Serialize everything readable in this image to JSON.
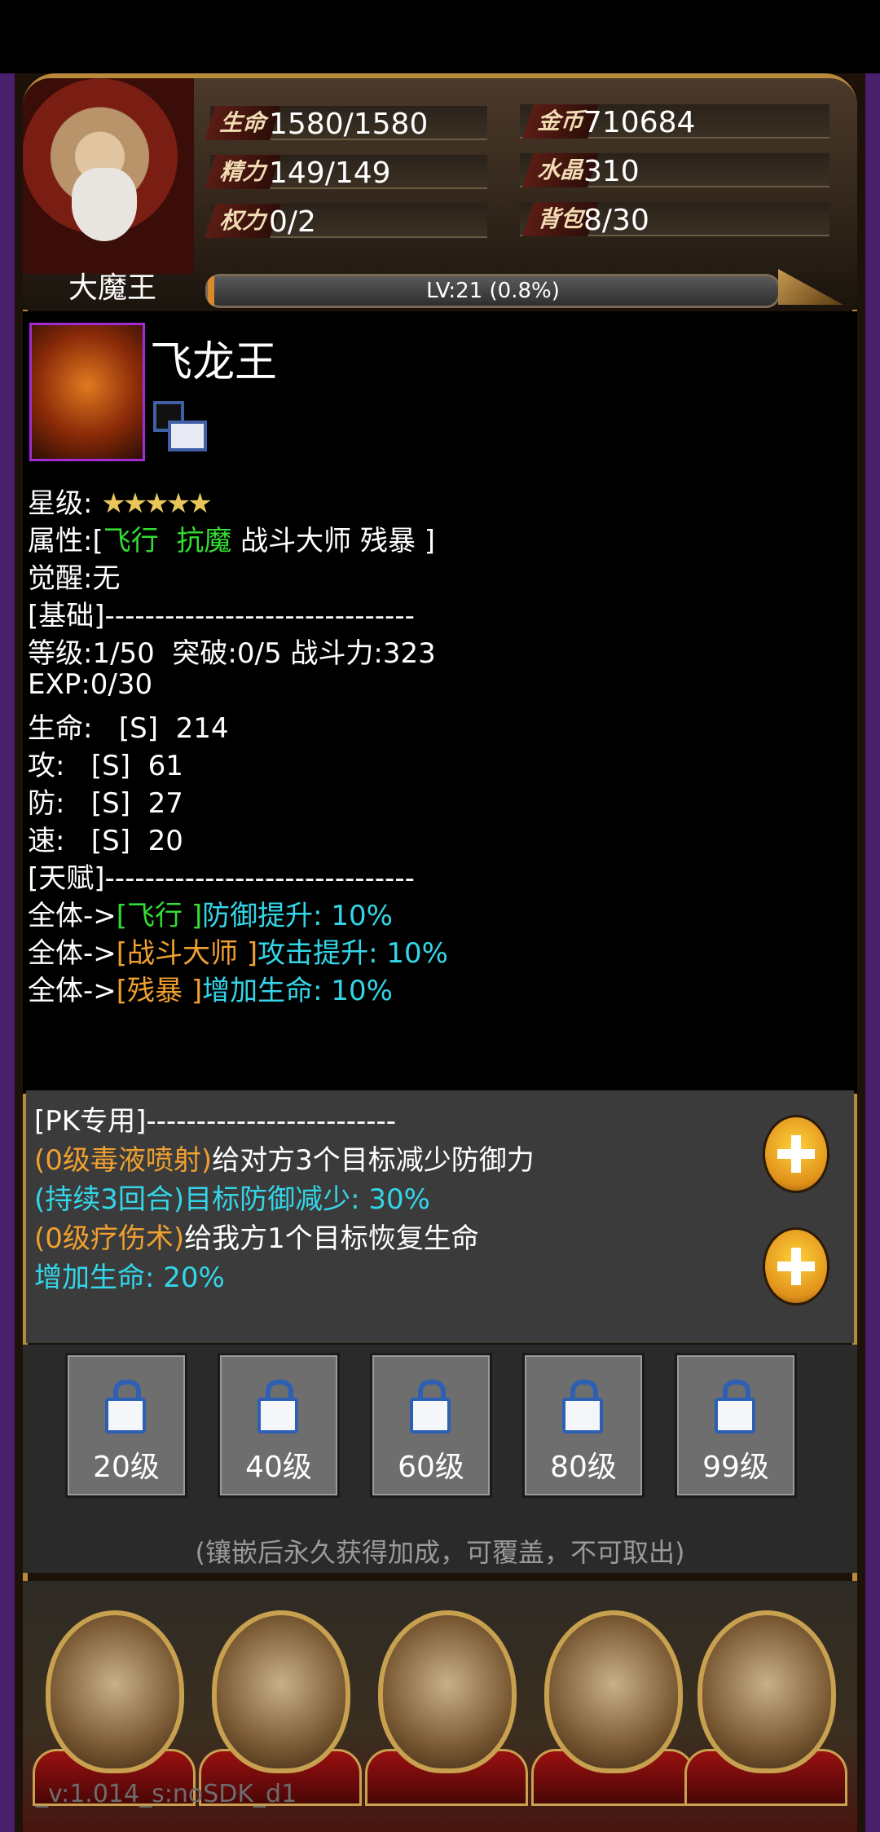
{
  "header": {
    "player_name": "大魔王",
    "stats": [
      {
        "icon_label": "生命",
        "value": "1580/1580"
      },
      {
        "icon_label": "精力",
        "value": "149/149"
      },
      {
        "icon_label": "权力",
        "value": "0/2"
      },
      {
        "icon_label": "金币",
        "value": "710684"
      },
      {
        "icon_label": "水晶",
        "value": "310"
      },
      {
        "icon_label": "背包",
        "value": "8/30"
      }
    ],
    "level_text": "LV:21 (0.8%)",
    "level_progress": 0.008
  },
  "card": {
    "name": "飞龙王",
    "star_label": "星级:",
    "stars": "★★★★★",
    "attr_prefix": "属性:[",
    "attr_green": "飞行  抗魔",
    "attr_rest": " 战斗大师 残暴 ]",
    "awaken": "觉醒:无",
    "basic_header": "[基础]-------------------------------",
    "level_line": "等级:1/50  突破:0/5 战斗力:323",
    "exp_line": "EXP:0/30",
    "hp_line": "生命:   [S]  214",
    "atk_line": "攻:   [S]  61",
    "def_line": "防:   [S]  27",
    "spd_line": "速:   [S]  20",
    "talent_header": "[天赋]-------------------------------",
    "talents": [
      {
        "prefix": "全体->",
        "tag": "[飞行 ]",
        "tag_color": "green",
        "effect": "防御提升: 10%"
      },
      {
        "prefix": "全体->",
        "tag": "[战斗大师 ]",
        "tag_color": "orange",
        "effect": "攻击提升: 10%"
      },
      {
        "prefix": "全体->",
        "tag": "[残暴 ]",
        "tag_color": "orange",
        "effect": "增加生命: 10%"
      }
    ]
  },
  "pk": {
    "header": "[PK专用]-------------------------",
    "skill1_name": "(0级毒液喷射)",
    "skill1_desc": "给对方3个目标减少防御力",
    "skill1_effect": "(持续3回合)目标防御减少: 30%",
    "skill2_name": "(0级疗伤术)",
    "skill2_desc": "给我方1个目标恢复生命",
    "skill2_effect": "增加生命: 20%"
  },
  "slots": [
    "20级",
    "40级",
    "60级",
    "80级",
    "99级"
  ],
  "hint": "(镶嵌后永久获得加成，可覆盖，不可取出)",
  "nav": [
    "armor-icon",
    "helmet-icon",
    "hero-icon",
    "treasure-chest-icon",
    "book-icon"
  ],
  "version": "_v:1.014_s:noSDK_d1"
}
